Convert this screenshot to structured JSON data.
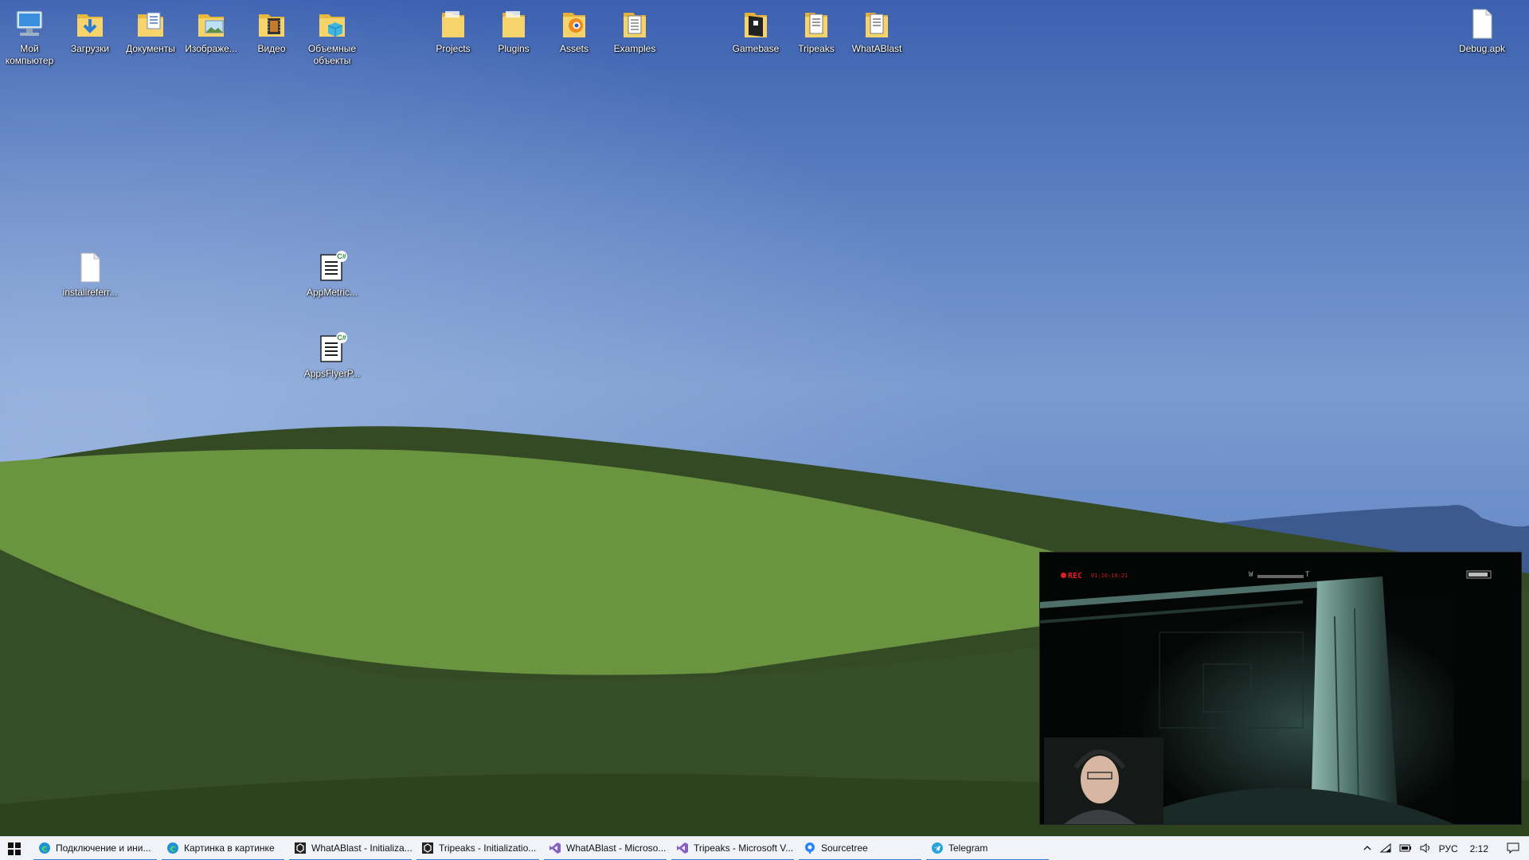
{
  "colors": {
    "sky_top": "#3d62b0",
    "hill_light": "#6b9440",
    "hill_dark": "#334a25",
    "taskbar_bg": "#f1f3f9",
    "active_underline": "#2f7fd6"
  },
  "desktop": {
    "icons": [
      {
        "label": "Мой компьютер",
        "icon": "computer-icon"
      },
      {
        "label": "Загрузки",
        "icon": "downloads-folder-icon"
      },
      {
        "label": "Документы",
        "icon": "documents-folder-icon"
      },
      {
        "label": "Изображе...",
        "icon": "pictures-folder-icon"
      },
      {
        "label": "Видео",
        "icon": "videos-folder-icon"
      },
      {
        "label": "Объемные объекты",
        "icon": "3d-objects-folder-icon"
      },
      {
        "label": "Projects",
        "icon": "folder-icon"
      },
      {
        "label": "Plugins",
        "icon": "folder-icon"
      },
      {
        "label": "Assets",
        "icon": "blender-file-icon"
      },
      {
        "label": "Examples",
        "icon": "folder-icon"
      },
      {
        "label": "Gamebase",
        "icon": "folder-icon"
      },
      {
        "label": "Tripeaks",
        "icon": "folder-icon"
      },
      {
        "label": "WhatABlast",
        "icon": "folder-icon"
      },
      {
        "label": "Debug.apk",
        "icon": "file-icon"
      },
      {
        "label": "installreferr...",
        "icon": "file-icon"
      },
      {
        "label": "AppMetric...",
        "icon": "csharp-file-icon"
      },
      {
        "label": "AppsFlyerP...",
        "icon": "csharp-file-icon"
      }
    ]
  },
  "pip": {
    "title": "Картинка в картинке",
    "rec_label": "REC",
    "timestamp": "01:16:18:21",
    "zoom_w": "W",
    "zoom_t": "T"
  },
  "taskbar": {
    "items": [
      {
        "label": "Подключение и ини...",
        "icon": "edge-icon"
      },
      {
        "label": "Картинка в картинке",
        "icon": "edge-icon"
      },
      {
        "label": "WhatABlast - Initializa...",
        "icon": "unity-icon"
      },
      {
        "label": "Tripeaks - Initializatio...",
        "icon": "unity-icon"
      },
      {
        "label": "WhatABlast - Microso...",
        "icon": "visual-studio-icon"
      },
      {
        "label": "Tripeaks - Microsoft V...",
        "icon": "visual-studio-icon"
      },
      {
        "label": "Sourcetree",
        "icon": "sourcetree-icon"
      },
      {
        "label": "Telegram",
        "icon": "telegram-icon"
      }
    ],
    "tray": {
      "language": "РУС",
      "time": "2:12"
    }
  }
}
